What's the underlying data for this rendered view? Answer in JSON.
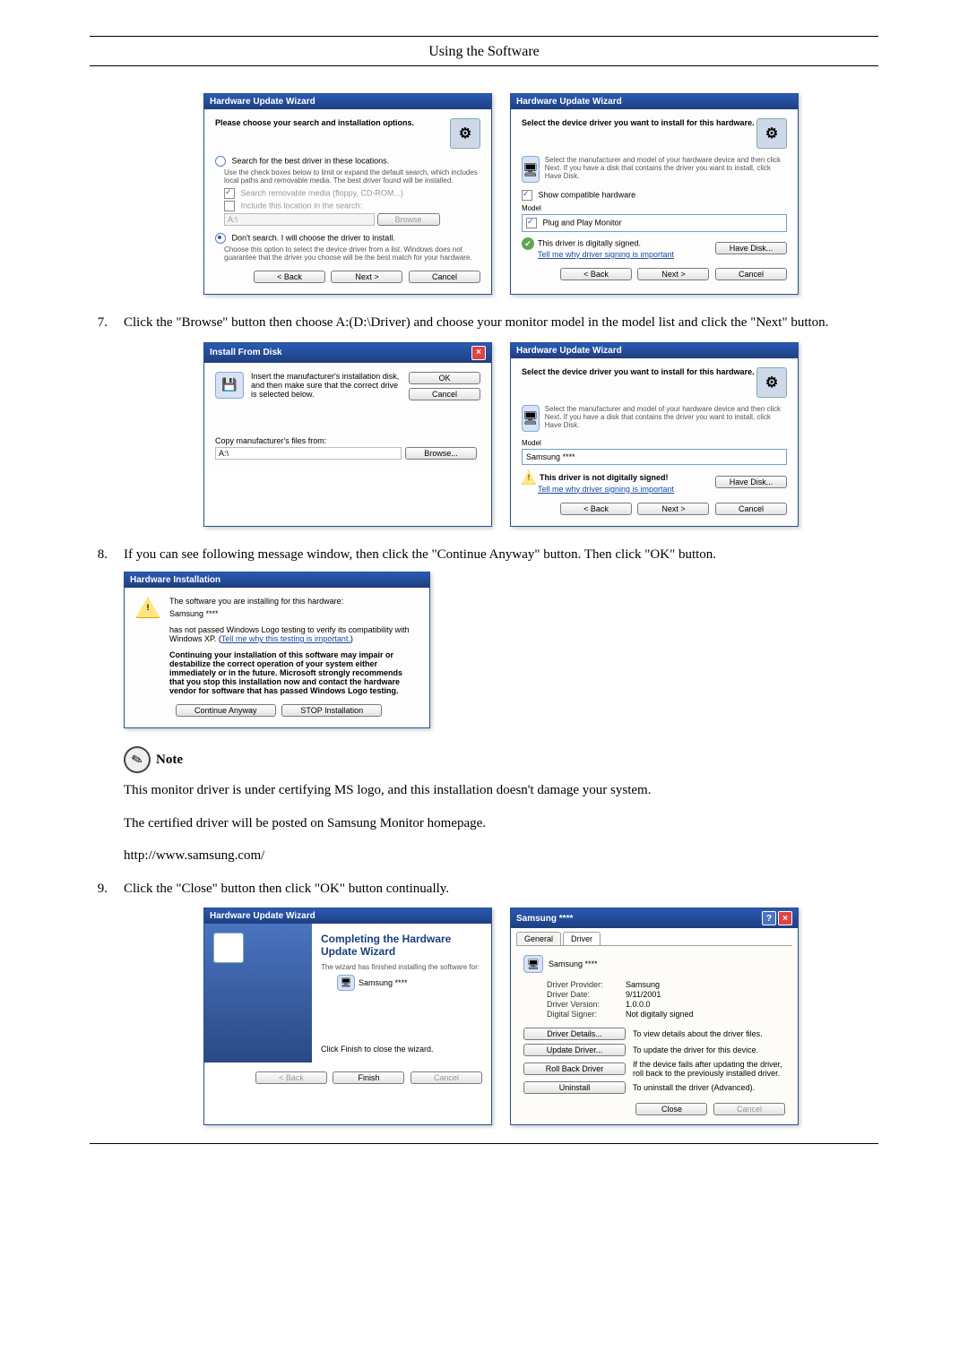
{
  "header": {
    "title": "Using the Software"
  },
  "steps": {
    "s7": {
      "num": "7.",
      "text": "Click the \"Browse\" button then choose A:(D:\\Driver) and choose your monitor model in the model list and click the \"Next\" button."
    },
    "s8": {
      "num": "8.",
      "text": "If you can see following message window, then click the \"Continue Anyway\" button. Then click \"OK\" button."
    },
    "s9": {
      "num": "9.",
      "text": "Click the \"Close\" button then click \"OK\" button continually."
    }
  },
  "note": {
    "label": "Note",
    "p1": "This monitor driver is under certifying MS logo, and this installation doesn't damage your system.",
    "p2": "The certified driver will be posted on Samsung Monitor homepage.",
    "p3": "http://www.samsung.com/"
  },
  "dlg_search": {
    "title": "Hardware Update Wizard",
    "head": "Please choose your search and installation options.",
    "r1": "Search for the best driver in these locations.",
    "r1sub": "Use the check boxes below to limit or expand the default search, which includes local paths and removable media. The best driver found will be installed.",
    "c1": "Search removable media (floppy, CD-ROM...)",
    "c2": "Include this location in the search:",
    "path": "A:\\",
    "browse": "Browse",
    "r2": "Don't search. I will choose the driver to install.",
    "r2sub": "Choose this option to select the device driver from a list. Windows does not guarantee that the driver you choose will be the best match for your hardware.",
    "back": "< Back",
    "next": "Next >",
    "cancel": "Cancel"
  },
  "dlg_select1": {
    "title": "Hardware Update Wizard",
    "head": "Select the device driver you want to install for this hardware.",
    "sub": "Select the manufacturer and model of your hardware device and then click Next. If you have a disk that contains the driver you want to install, click Have Disk.",
    "compat": "Show compatible hardware",
    "model_label": "Model",
    "model": "Plug and Play Monitor",
    "signed": "This driver is digitally signed.",
    "tell": "Tell me why driver signing is important",
    "have": "Have Disk...",
    "back": "< Back",
    "next": "Next >",
    "cancel": "Cancel"
  },
  "dlg_install_disk": {
    "title": "Install From Disk",
    "msg": "Insert the manufacturer's installation disk, and then make sure that the correct drive is selected below.",
    "ok": "OK",
    "cancel": "Cancel",
    "copy": "Copy manufacturer's files from:",
    "path": "A:\\",
    "browse": "Browse..."
  },
  "dlg_select2": {
    "title": "Hardware Update Wizard",
    "head": "Select the device driver you want to install for this hardware.",
    "sub": "Select the manufacturer and model of your hardware device and then click Next. If you have a disk that contains the driver you want to install, click Have Disk.",
    "model_label": "Model",
    "model": "Samsung ****",
    "unsigned": "This driver is not digitally signed!",
    "tell": "Tell me why driver signing is important",
    "have": "Have Disk...",
    "back": "< Back",
    "next": "Next >",
    "cancel": "Cancel"
  },
  "dlg_hwinstall": {
    "title": "Hardware Installation",
    "l1": "The software you are installing for this hardware:",
    "l2": "Samsung ****",
    "l3": "has not passed Windows Logo testing to verify its compatibility with Windows XP. (",
    "l3link": "Tell me why this testing is important.",
    "l3end": ")",
    "warn": "Continuing your installation of this software may impair or destabilize the correct operation of your system either immediately or in the future. Microsoft strongly recommends that you stop this installation now and contact the hardware vendor for software that has passed Windows Logo testing.",
    "cont": "Continue Anyway",
    "stop": "STOP Installation"
  },
  "dlg_finish": {
    "title": "Hardware Update Wizard",
    "h": "Completing the Hardware Update Wizard",
    "l1": "The wizard has finished installing the software for:",
    "l2": "Samsung ****",
    "l3": "Click Finish to close the wizard.",
    "back": "< Back",
    "finish": "Finish",
    "cancel": "Cancel"
  },
  "dlg_props": {
    "title": "Samsung ****",
    "tab_general": "General",
    "tab_driver": "Driver",
    "name": "Samsung ****",
    "provider_k": "Driver Provider:",
    "provider_v": "Samsung",
    "date_k": "Driver Date:",
    "date_v": "9/11/2001",
    "version_k": "Driver Version:",
    "version_v": "1.0.0.0",
    "signer_k": "Digital Signer:",
    "signer_v": "Not digitally signed",
    "b_details": "Driver Details...",
    "b_details_d": "To view details about the driver files.",
    "b_update": "Update Driver...",
    "b_update_d": "To update the driver for this device.",
    "b_rollback": "Roll Back Driver",
    "b_rollback_d": "If the device fails after updating the driver, roll back to the previously installed driver.",
    "b_uninstall": "Uninstall",
    "b_uninstall_d": "To uninstall the driver (Advanced).",
    "close": "Close",
    "cancel": "Cancel"
  }
}
